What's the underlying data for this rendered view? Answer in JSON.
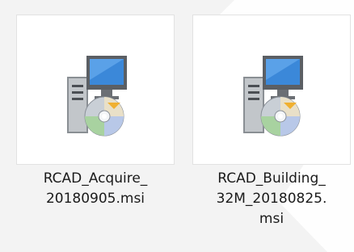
{
  "files": [
    {
      "name": "RCAD_Acquire_20180905.msi",
      "label_lines": [
        "RCAD_Acquire_",
        "20180905.msi"
      ],
      "icon": "msi-installer-icon"
    },
    {
      "name": "RCAD_Building_32M_20180825.msi",
      "label_lines": [
        "RCAD_Building_",
        "32M_20180825.",
        "msi"
      ],
      "icon": "msi-installer-icon"
    }
  ],
  "colors": {
    "background": "#f3f3f3",
    "tile": "#ffffff",
    "tile_border": "#e2e2e2",
    "text": "#1a1a1a",
    "monitor_screen": "#3b88d9",
    "disc": "#c9cfd6"
  }
}
